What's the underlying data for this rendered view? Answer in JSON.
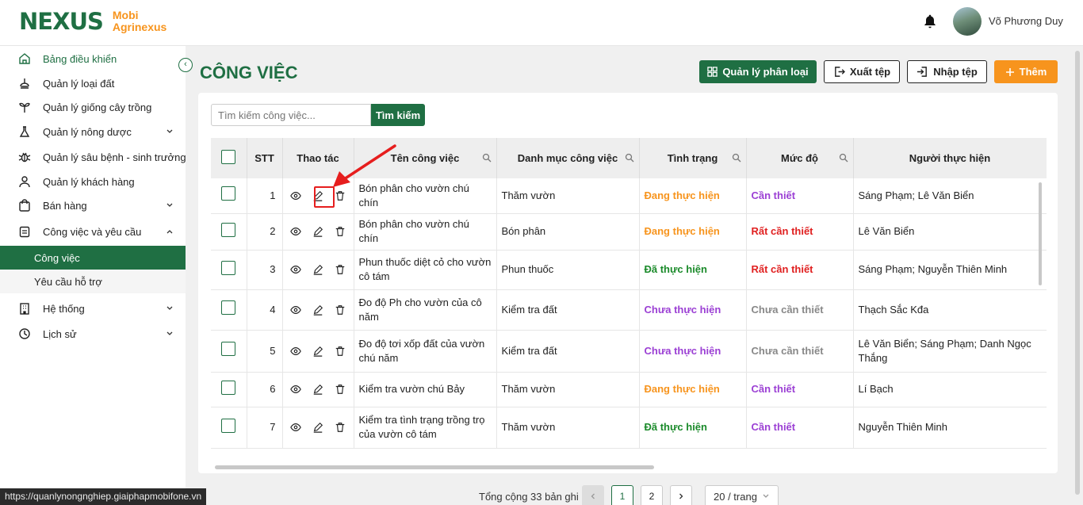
{
  "brand": {
    "logo_text": "NEXUS",
    "name_line1": "Mobi",
    "name_line2": "Agrinexus"
  },
  "header": {
    "username": "Võ Phương Duy"
  },
  "sidebar": {
    "items": [
      {
        "label": "Bảng điều khiển"
      },
      {
        "label": "Quản lý loại đất"
      },
      {
        "label": "Quản lý giống cây trồng"
      },
      {
        "label": "Quản lý nông dược"
      },
      {
        "label": "Quản lý sâu bệnh - sinh trưởng"
      },
      {
        "label": "Quản lý khách hàng"
      },
      {
        "label": "Bán hàng"
      },
      {
        "label": "Công việc và yêu cầu"
      },
      {
        "label": "Hệ thống"
      },
      {
        "label": "Lịch sử"
      }
    ],
    "subitems": [
      {
        "label": "Công việc"
      },
      {
        "label": "Yêu cầu hỗ trợ"
      }
    ]
  },
  "page": {
    "title": "CÔNG VIỆC"
  },
  "toolbar": {
    "manage_label": "Quản lý phân loại",
    "export_label": "Xuất tệp",
    "import_label": "Nhập tệp",
    "add_label": "Thêm"
  },
  "search": {
    "placeholder": "Tìm kiếm công việc...",
    "button_label": "Tìm kiếm"
  },
  "table": {
    "headers": {
      "stt": "STT",
      "actions": "Thao tác",
      "name": "Tên công việc",
      "category": "Danh mục công việc",
      "status": "Tình trạng",
      "level": "Mức độ",
      "assignee": "Người thực hiện"
    },
    "rows": [
      {
        "stt": "1",
        "name": "Bón phân cho vườn chú chín",
        "category": "Thăm vườn",
        "status": "Đang thực hiện",
        "level": "Cần thiết",
        "assignee": "Sáng Phạm; Lê  Văn Biển"
      },
      {
        "stt": "2",
        "name": "Bón phân cho vườn chú chín",
        "category": "Bón phân",
        "status": "Đang thực hiện",
        "level": "Rất cần thiết",
        "assignee": "Lê  Văn Biển"
      },
      {
        "stt": "3",
        "name": "Phun thuốc diệt cỏ cho vườn cô tám",
        "category": "Phun thuốc",
        "status": "Đã thực hiện",
        "level": "Rất cần thiết",
        "assignee": "Sáng Phạm; Nguyễn  Thiên Minh"
      },
      {
        "stt": "4",
        "name": "Đo độ Ph cho vườn của cô năm",
        "category": "Kiểm tra đất",
        "status": "Chưa thực hiện",
        "level": "Chưa cần thiết",
        "assignee": "Thạch Sắc Kđa"
      },
      {
        "stt": "5",
        "name": "Đo độ tơi xốp đất của vườn chú năm",
        "category": "Kiểm tra đất",
        "status": "Chưa thực hiện",
        "level": "Chưa cần thiết",
        "assignee": "Lê  Văn Biển; Sáng Phạm; Danh  Ngọc Thắng"
      },
      {
        "stt": "6",
        "name": "Kiểm tra vườn chú Bảy",
        "category": "Thăm vườn",
        "status": "Đang thực hiện",
        "level": "Cần thiết",
        "assignee": "Lí  Bạch"
      },
      {
        "stt": "7",
        "name": "Kiểm tra tình trạng trồng trọ của vườn cô tám",
        "category": "Thăm vườn",
        "status": "Đã thực hiện",
        "level": "Cần thiết",
        "assignee": "Nguyễn  Thiên Minh"
      }
    ]
  },
  "pagination": {
    "total_text": "Tổng cộng 33 bản ghi",
    "pages": [
      "1",
      "2"
    ],
    "page_size": "20 / trang"
  },
  "statusbar": {
    "url": "https://quanlynongnghiep.giaiphapmobifone.vn"
  },
  "colors": {
    "primary": "#1f6f43",
    "accent": "#f7941d",
    "doing": "#f7941d",
    "done": "#1a8a2a",
    "pending": "#9b3fd4",
    "urgent": "#e02020"
  }
}
